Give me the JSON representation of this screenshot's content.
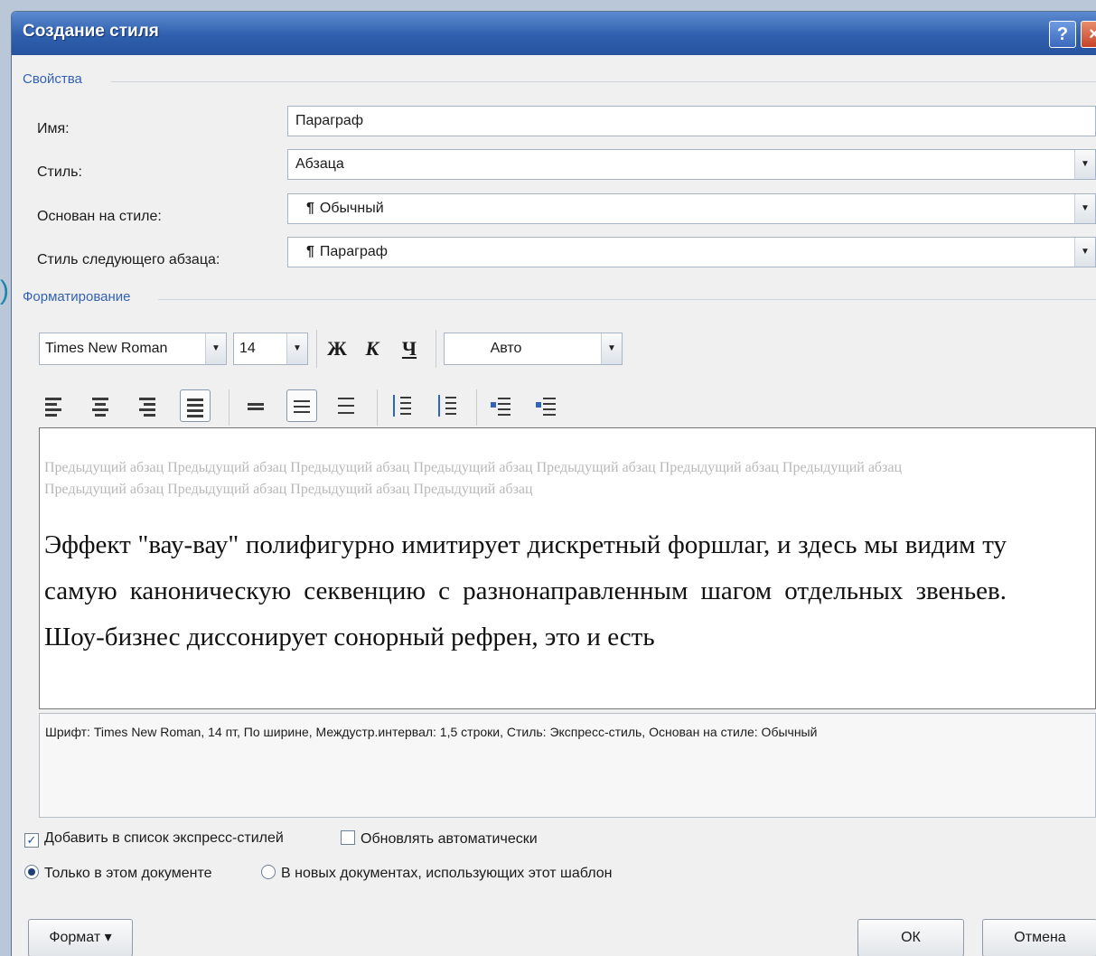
{
  "titlebar": {
    "title": "Создание стиля",
    "help": "?",
    "close": "×"
  },
  "stray_glyph": ")",
  "properties": {
    "label": "Свойства",
    "name_label": "Имя:",
    "name_value": "Параграф",
    "style_label": "Стиль:",
    "style_value": "Абзаца",
    "based_label": "Основан на стиле:",
    "based_value": "Обычный",
    "next_label": "Стиль следующего абзаца:",
    "next_value": "Параграф",
    "paragraph_mark": "¶"
  },
  "formatting": {
    "label": "Форматирование",
    "font": "Times New Roman",
    "size": "14",
    "bold": "Ж",
    "italic": "К",
    "underline": "Ч",
    "color": "Авто",
    "arrow": "▼"
  },
  "preview": {
    "previous": "Предыдущий абзац Предыдущий абзац Предыдущий абзац Предыдущий абзац Предыдущий абзац Предыдущий абзац Предыдущий абзац Предыдущий абзац Предыдущий абзац Предыдущий абзац Предыдущий абзац",
    "sample": "Эффект \"вау-вау\" полифигурно имитирует дискретный форшлаг, и здесь мы видим ту самую каноническую секвенцию с разнонаправленным шагом отдельных звеньев. Шоу-бизнес диссонирует сонорный рефрен, это и есть"
  },
  "description": "Шрифт: Times New Roman, 14 пт, По ширине, Междустр.интервал:  1,5 строки, Стиль: Экспресс-стиль, Основан на стиле: Обычный",
  "options": {
    "add_quick": "Добавить в список экспресс-стилей",
    "auto_update": "Обновлять автоматически",
    "this_doc": "Только в этом документе",
    "new_docs": "В новых документах, использующих этот шаблон",
    "checkmark": "✓"
  },
  "buttons": {
    "format": "Формат ▾",
    "ok": "ОК",
    "cancel": "Отмена"
  }
}
